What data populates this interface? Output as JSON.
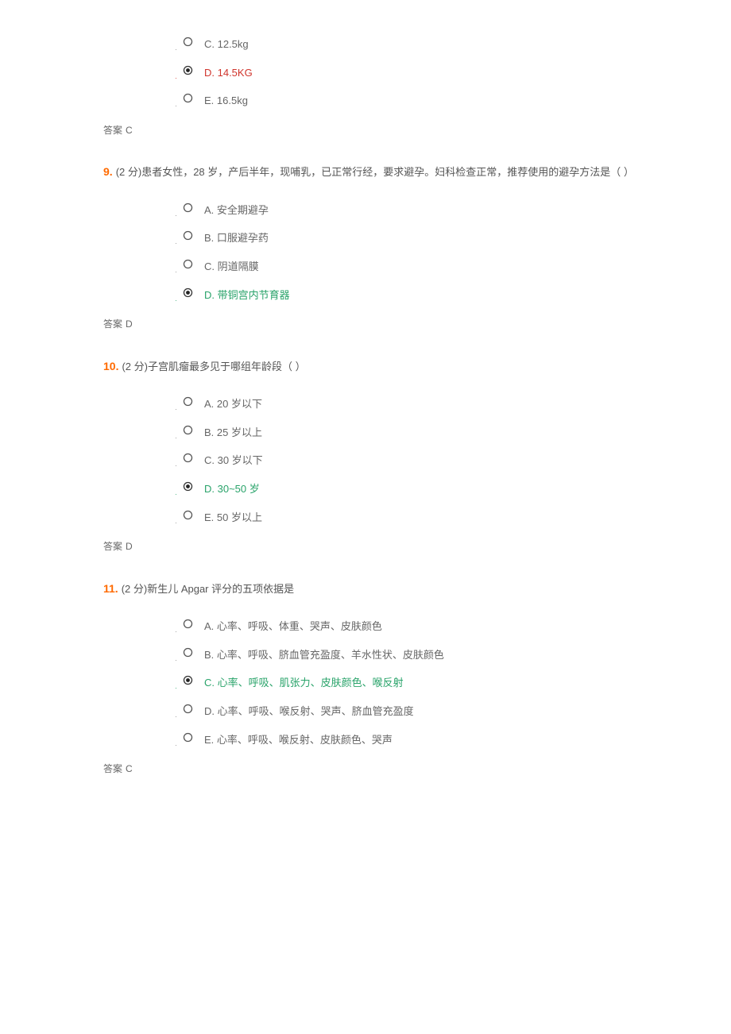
{
  "answer_word": "答案",
  "questions": [
    {
      "number": "",
      "text": "",
      "options": [
        {
          "letter": "C",
          "text": "C. 12.5kg",
          "selected": false,
          "status": "normal"
        },
        {
          "letter": "D",
          "text": "D. 14.5KG",
          "selected": true,
          "status": "wrong"
        },
        {
          "letter": "E",
          "text": "E. 16.5kg",
          "selected": false,
          "status": "normal"
        }
      ],
      "answer": "C"
    },
    {
      "number": "9.",
      "text": "(2 分)患者女性，28 岁，产后半年，现哺乳，已正常行经，要求避孕。妇科检查正常，推荐使用的避孕方法是（ ）",
      "options": [
        {
          "letter": "A",
          "text": "A. 安全期避孕",
          "selected": false,
          "status": "normal"
        },
        {
          "letter": "B",
          "text": "B. 口服避孕药",
          "selected": false,
          "status": "normal"
        },
        {
          "letter": "C",
          "text": "C. 阴道隔膜",
          "selected": false,
          "status": "normal"
        },
        {
          "letter": "D",
          "text": "D. 带铜宫内节育器",
          "selected": true,
          "status": "correct"
        }
      ],
      "answer": "D"
    },
    {
      "number": "10.",
      "text": "(2 分)子宫肌瘤最多见于哪组年龄段（ ）",
      "options": [
        {
          "letter": "A",
          "text": "A. 20 岁以下",
          "selected": false,
          "status": "normal"
        },
        {
          "letter": "B",
          "text": "B. 25 岁以上",
          "selected": false,
          "status": "normal"
        },
        {
          "letter": "C",
          "text": "C. 30 岁以下",
          "selected": false,
          "status": "normal"
        },
        {
          "letter": "D",
          "text": "D. 30~50 岁",
          "selected": true,
          "status": "correct"
        },
        {
          "letter": "E",
          "text": "E. 50 岁以上",
          "selected": false,
          "status": "normal"
        }
      ],
      "answer": "D"
    },
    {
      "number": "11.",
      "text": "(2 分)新生儿 Apgar 评分的五项依据是",
      "options": [
        {
          "letter": "A",
          "text": "A. 心率、呼吸、体重、哭声、皮肤颜色",
          "selected": false,
          "status": "normal"
        },
        {
          "letter": "B",
          "text": "B. 心率、呼吸、脐血管充盈度、羊水性状、皮肤颜色",
          "selected": false,
          "status": "normal"
        },
        {
          "letter": "C",
          "text": "C. 心率、呼吸、肌张力、皮肤颜色、喉反射",
          "selected": true,
          "status": "correct"
        },
        {
          "letter": "D",
          "text": "D. 心率、呼吸、喉反射、哭声、脐血管充盈度",
          "selected": false,
          "status": "normal"
        },
        {
          "letter": "E",
          "text": "E. 心率、呼吸、喉反射、皮肤颜色、哭声",
          "selected": false,
          "status": "normal"
        }
      ],
      "answer": "C"
    }
  ]
}
